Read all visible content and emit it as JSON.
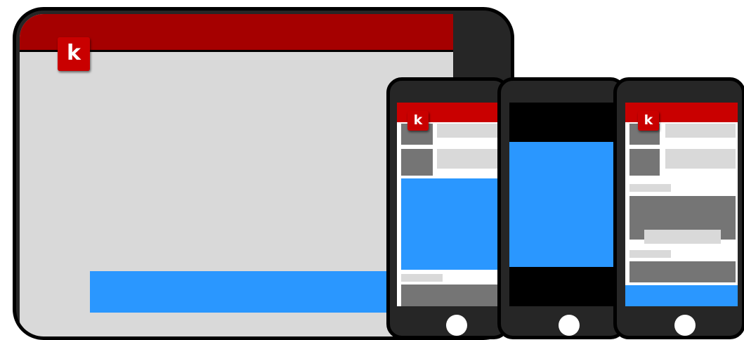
{
  "tablet": {
    "logo_text": "k"
  },
  "phones": [
    {
      "logo_text": "k"
    },
    {},
    {
      "logo_text": "k"
    }
  ],
  "colors": {
    "brand_red": "#c90000",
    "header_red": "#a50000",
    "accent_blue": "#2a97ff",
    "placeholder_light": "#d9d9d9",
    "placeholder_dark": "#757575",
    "device_body": "#262626"
  }
}
